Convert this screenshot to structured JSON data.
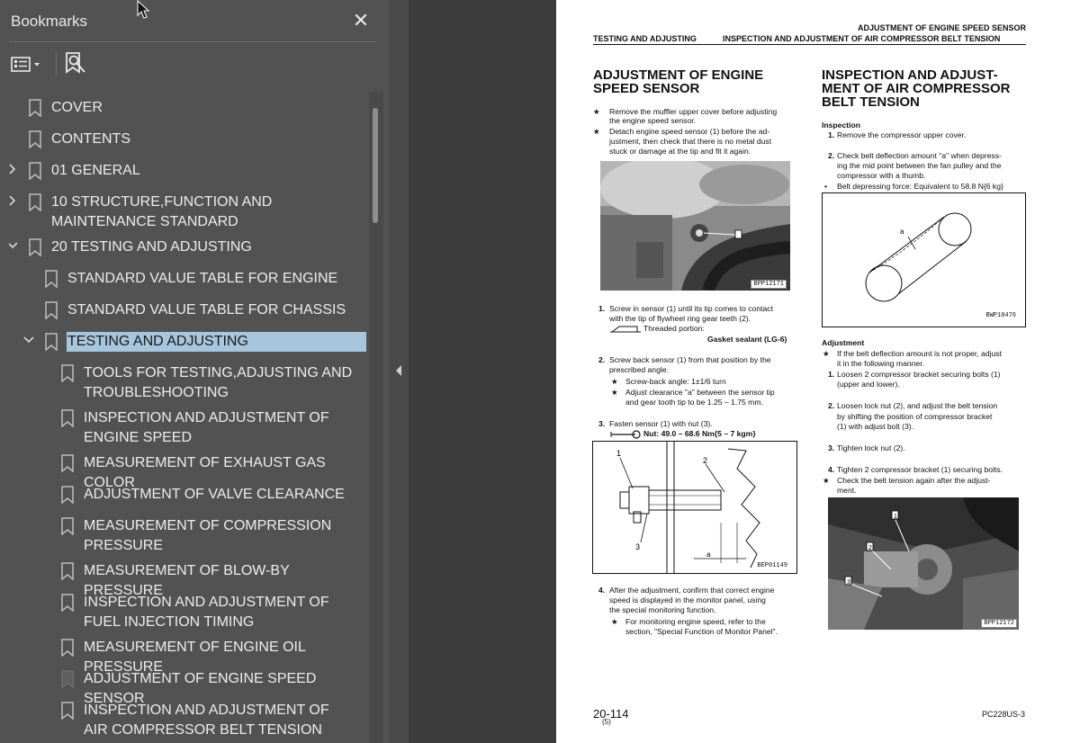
{
  "sidebar": {
    "title": "Bookmarks",
    "close_symbol": "✕",
    "items": [
      {
        "label": "COVER"
      },
      {
        "label": "CONTENTS"
      },
      {
        "label": "01 GENERAL"
      },
      {
        "label": "10 STRUCTURE,FUNCTION AND MAINTENANCE STANDARD"
      },
      {
        "label": "20 TESTING AND ADJUSTING"
      },
      {
        "label": "STANDARD VALUE TABLE FOR ENGINE"
      },
      {
        "label": "STANDARD VALUE TABLE FOR CHASSIS"
      },
      {
        "label": "TESTING AND ADJUSTING"
      },
      {
        "label": "TOOLS FOR TESTING,ADJUSTING AND TROUBLESHOOTING"
      },
      {
        "label": "INSPECTION AND ADJUSTMENT OF ENGINE SPEED"
      },
      {
        "label": "MEASUREMENT OF EXHAUST GAS COLOR"
      },
      {
        "label": "ADJUSTMENT OF VALVE CLEARANCE"
      },
      {
        "label": "MEASUREMENT OF COMPRESSION PRESSURE"
      },
      {
        "label": "MEASUREMENT OF BLOW-BY PRESSURE"
      },
      {
        "label": "INSPECTION AND ADJUSTMENT OF FUEL INJECTION TIMING"
      },
      {
        "label": "MEASUREMENT OF ENGINE OIL PRESSURE"
      },
      {
        "label": "ADJUSTMENT OF ENGINE SPEED SENSOR"
      },
      {
        "label": "INSPECTION AND ADJUSTMENT OF AIR COMPRESSOR BELT TENSION"
      }
    ],
    "icons": {
      "options": "list-options-icon",
      "find": "find-bookmark-icon",
      "bookmark": "bookmark-icon",
      "expand": "chevron-right-icon",
      "collapse": "chevron-down-icon"
    },
    "selection_color": "#a7c6de"
  },
  "page": {
    "header_right": "ADJUSTMENT OF ENGINE SPEED SENSOR",
    "header_left": "TESTING AND ADJUSTING",
    "header_sub": "INSPECTION AND ADJUSTMENT OF AIR COMPRESSOR BELT TENSION",
    "left": {
      "title_l1": "ADJUSTMENT OF ENGINE",
      "title_l2": "SPEED SENSOR",
      "star1_l1": "Remove the muffler upper cover before adjusting",
      "star1_l2": "the engine speed sensor.",
      "star2_l1": "Detach engine speed sensor (1) before the ad-",
      "star2_l2": "justment, then check that there is no metal dust",
      "star2_l3": "stuck or damage at the tip and fit it again.",
      "photo1_code": "BPP12171",
      "s1_l1": "Screw in sensor (1) until its tip comes to contact",
      "s1_l2": "with the tip of flywheel ring gear teeth (2).",
      "s1_l3": "Threaded portion:",
      "s1_l4": "Gasket sealant (LG-6)",
      "s2_l1": "Screw back sensor (1) from that position by the",
      "s2_l2": "prescribed angle.",
      "s2_l3": "Screw-back angle: 1±1/6 turn",
      "s2_l4": "Adjust clearance \"a\" between the sensor tip",
      "s2_l5": "and gear tooth tip to be 1.25 – 1.75 mm.",
      "s3_l1": "Fasten sensor (1) with nut (3).",
      "s3_l2": "Nut: 49.0 – 68.6 Nm{5 – 7 kgm}",
      "fig2_code": "BEP01149",
      "s4_l1": "After the adjustment, confirm that correct engine",
      "s4_l2": "speed is displayed in the monitor panel, using",
      "s4_l3": "the special monitoring function.",
      "s4_l4": "For monitoring engine speed, refer to the",
      "s4_l5": "section, \"Special Function of Monitor Panel\"."
    },
    "right": {
      "title_l1": "INSPECTION AND ADJUST-",
      "title_l2": "MENT OF AIR COMPRESSOR",
      "title_l3": "BELT TENSION",
      "inspection": "Inspection",
      "i1": "Remove the compressor upper cover.",
      "i2_l1": "Check belt deflection amount \"a\" when depress-",
      "i2_l2": "ing the mid point between the fan pulley and the",
      "i2_l3": "compressor with a thumb.",
      "i2_l4": "Belt depressing force: Equivalent to 58.8 N{6 kg}",
      "fig3_code": "BWP10476",
      "adjustment": "Adjustment",
      "a_star_l1": "If the belt deflection amount is not proper, adjust",
      "a_star_l2": "it in the following manner.",
      "a1_l1": "Loosen 2 compressor bracket securing bolts (1)",
      "a1_l2": "(upper and lower).",
      "a2_l1": "Loosen lock nut (2), and adjust the belt tension",
      "a2_l2": "by shifting the position of compressor bracket",
      "a2_l3": "(1) with adjust bolt (3).",
      "a3": "Tighten lock nut (2).",
      "a4": "Tighten 2 compressor bracket (1) securing bolts.",
      "a_star2_l1": "Check the belt tension again after the adjust-",
      "a_star2_l2": "ment.",
      "photo2_code": "BPP12172"
    },
    "footer_page": "20-114",
    "footer_rev": "(5)",
    "footer_model": "PC228US-3"
  }
}
